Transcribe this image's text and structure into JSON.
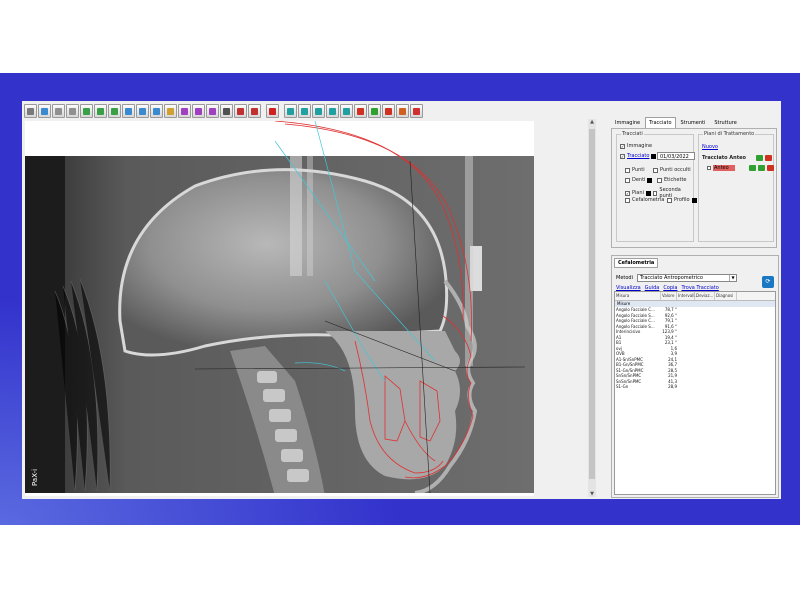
{
  "colors": {
    "slide_bg": "#3333cc",
    "app_bg": "#f0f0f0",
    "trace_red": "#e03030",
    "trace_cyan": "#40c8d8",
    "link_blue": "#0000cc"
  },
  "toolbar": {
    "buttons": [
      {
        "name": "select-tool-icon",
        "color": "#7a7a7a"
      },
      {
        "name": "move-tool-icon",
        "color": "#3a8ad0"
      },
      {
        "name": "undo-icon",
        "color": "#909090"
      },
      {
        "name": "redo-icon",
        "color": "#909090"
      },
      {
        "name": "rotate-icon",
        "color": "#3aa048"
      },
      {
        "name": "flip-horizontal-icon",
        "color": "#3aa048"
      },
      {
        "name": "flip-vertical-icon",
        "color": "#3aa048"
      },
      {
        "name": "contrast-icon",
        "color": "#3a8ad0"
      },
      {
        "name": "brightness-icon",
        "color": "#3a8ad0"
      },
      {
        "name": "zoom-in-icon",
        "color": "#3a8ad0"
      },
      {
        "name": "zoom-out-icon",
        "color": "#d0a030"
      },
      {
        "name": "measure-horizontal-icon",
        "color": "#a040c0"
      },
      {
        "name": "measure-vertical-icon",
        "color": "#a040c0"
      },
      {
        "name": "measure-angle-icon",
        "color": "#a040c0"
      },
      {
        "name": "profile-icon",
        "color": "#505050"
      },
      {
        "name": "pen-icon",
        "color": "#c03030"
      },
      {
        "name": "shape-icon",
        "color": "#c03030"
      },
      {
        "name": "sep",
        "color": ""
      },
      {
        "name": "record-icon",
        "color": "#d02020"
      },
      {
        "name": "sep",
        "color": ""
      },
      {
        "name": "screen-icon",
        "color": "#20a0a0"
      },
      {
        "name": "save-icon",
        "color": "#20a0a0"
      },
      {
        "name": "save-as-icon",
        "color": "#20a0a0"
      },
      {
        "name": "print-icon",
        "color": "#20a0a0"
      },
      {
        "name": "export-icon",
        "color": "#20a0a0"
      },
      {
        "name": "pdf-icon",
        "color": "#d03020"
      },
      {
        "name": "confirm-icon",
        "color": "#30a030"
      },
      {
        "name": "close-icon",
        "color": "#d03020"
      },
      {
        "name": "exit-icon",
        "color": "#d06020"
      },
      {
        "name": "power-icon",
        "color": "#d03030"
      }
    ]
  },
  "image": {
    "watermark": "PaX-i"
  },
  "tabs": [
    {
      "label": "Immagine",
      "active": false
    },
    {
      "label": "Tracciato",
      "active": true
    },
    {
      "label": "Strumenti",
      "active": false
    },
    {
      "label": "Strutture",
      "active": false
    }
  ],
  "tracciati": {
    "title": "Tracciati",
    "immagine_label": "Immagine",
    "tracciato_label": "Tracciato",
    "date": "01/03/2022",
    "punti_label": "Punti",
    "punti_occulti_label": "Punti occulti",
    "denti_label": "Denti",
    "etichette_label": "Etichette",
    "piani_label": "Piani",
    "seconda_punti_label": "Seconda punti",
    "cefalometria_label": "Cefalometria",
    "profilo_label": "Profilo"
  },
  "piani": {
    "title": "Piani di Trattamento",
    "nuovo_label": "Nuovo",
    "tracciato_label": "Tracciato Anteo",
    "item_label": "Anteo"
  },
  "cefalometria": {
    "tab_label": "Cefalometria",
    "metodi_label": "Metodi",
    "method_value": "Tracciato Antropometrico",
    "links": [
      "Visualizza",
      "Guida",
      "Copia",
      "Trova Tracciato"
    ],
    "columns": [
      "Misura",
      "Valore",
      "Intervall...",
      "Deviaz...",
      "Diagnosi"
    ],
    "group": "Misure",
    "rows": [
      {
        "misura": "Angolo Facciale C...",
        "valore": "78,7 °"
      },
      {
        "misura": "Angolo Facciale S...",
        "valore": "92,6 °"
      },
      {
        "misura": "Angolo Facciale C...",
        "valore": "79,1 °"
      },
      {
        "misura": "Angolo Facciale S...",
        "valore": "91,6 °"
      },
      {
        "misura": "Interincisivo",
        "valore": "123,9 °"
      },
      {
        "misura": "A1",
        "valore": "19,4 °"
      },
      {
        "misura": "B1",
        "valore": "23,1 °"
      },
      {
        "misura": "ovj",
        "valore": "1,6"
      },
      {
        "misura": "OVB",
        "valore": "3,9"
      },
      {
        "misura": "A1-Sn/SnPMC",
        "valore": "24,1"
      },
      {
        "misura": "B1-Gn/SnPMC",
        "valore": "36,7"
      },
      {
        "misura": "S1-Gn/SnPMC",
        "valore": "28,5"
      },
      {
        "misura": "SnSn/SnPMC",
        "valore": "21,9"
      },
      {
        "misura": "SnSn/SnPMC",
        "valore": "41,3"
      },
      {
        "misura": "S1-Gn",
        "valore": "28,9"
      }
    ]
  }
}
